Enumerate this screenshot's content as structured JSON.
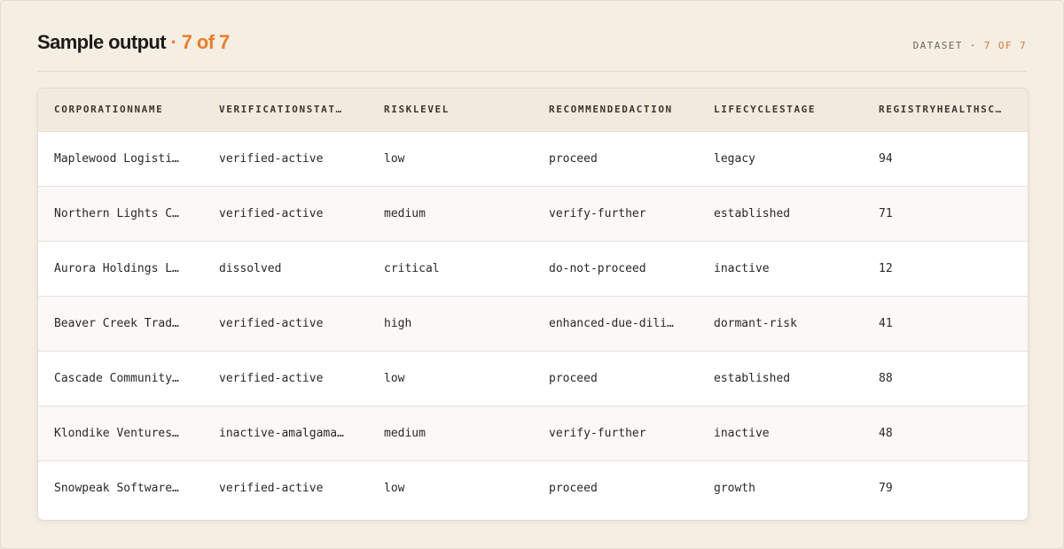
{
  "header": {
    "title": "Sample output",
    "title_separator": " · ",
    "title_count": "7 of 7",
    "meta_label": "DATASET · ",
    "meta_count": "7 OF 7"
  },
  "colors": {
    "accent": "#ee7d27",
    "background": "#f3ede1",
    "header_row": "#f1eadd"
  },
  "table": {
    "columns": [
      "CORPORATIONNAME",
      "VERIFICATIONSTAT…",
      "RISKLEVEL",
      "RECOMMENDEDACTION",
      "LIFECYCLESTAGE",
      "REGISTRYHEALTHSC…"
    ],
    "rows": [
      [
        "Maplewood Logisti…",
        "verified-active",
        "low",
        "proceed",
        "legacy",
        "94"
      ],
      [
        "Northern Lights C…",
        "verified-active",
        "medium",
        "verify-further",
        "established",
        "71"
      ],
      [
        "Aurora Holdings L…",
        "dissolved",
        "critical",
        "do-not-proceed",
        "inactive",
        "12"
      ],
      [
        "Beaver Creek Trad…",
        "verified-active",
        "high",
        "enhanced-due-dili…",
        "dormant-risk",
        "41"
      ],
      [
        "Cascade Community…",
        "verified-active",
        "low",
        "proceed",
        "established",
        "88"
      ],
      [
        "Klondike Ventures…",
        "inactive-amalgama…",
        "medium",
        "verify-further",
        "inactive",
        "48"
      ],
      [
        "Snowpeak Software…",
        "verified-active",
        "low",
        "proceed",
        "growth",
        "79"
      ]
    ]
  }
}
